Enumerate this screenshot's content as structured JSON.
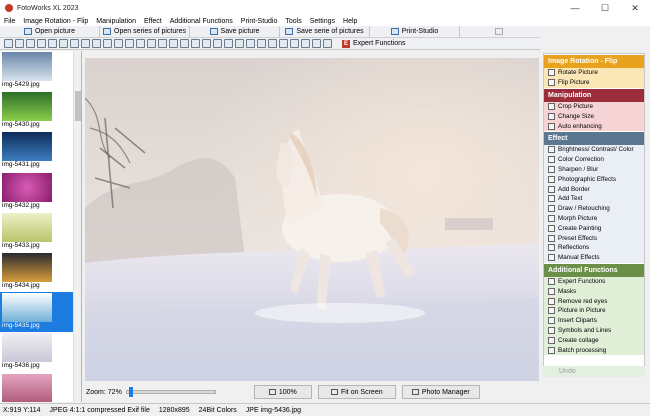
{
  "window": {
    "title": "FotoWorks XL 2023",
    "min": "—",
    "max": "☐",
    "close": "✕"
  },
  "menu": [
    "File",
    "Image Rotation - Flip",
    "Manipulation",
    "Effect",
    "Additional Functions",
    "Print-Studio",
    "Tools",
    "Settings",
    "Help"
  ],
  "toolbar": {
    "open_picture": "Open picture",
    "open_series": "Open series of pictures",
    "save_picture": "Save picture",
    "save_series": "Save serie of pictures",
    "print_studio": "Print-Studio",
    "disabled_label": "",
    "expert_functions": "Expert Functions"
  },
  "thumbnails": [
    {
      "name": "img-5429.jpg",
      "color1": "#6a86a8",
      "color2": "#d8e3ee"
    },
    {
      "name": "img-5430.jpg",
      "color1": "#2d6e2a",
      "color2": "#8ccf4a"
    },
    {
      "name": "img-5431.jpg",
      "color1": "#0d2c5a",
      "color2": "#3d7ec0"
    },
    {
      "name": "img-5432.jpg",
      "color1": "#8a1d6e",
      "color2": "#d85bb4"
    },
    {
      "name": "img-5433.jpg",
      "color1": "#b9c46a",
      "color2": "#eef0c8"
    },
    {
      "name": "img-5434.jpg",
      "color1": "#2a2a30",
      "color2": "#d89e3a"
    },
    {
      "name": "img-5435.jpg",
      "color1": "#6fb0d6",
      "color2": "#ffffff"
    },
    {
      "name": "img-5436.jpg",
      "color1": "#c8c8d8",
      "color2": "#f0eef2"
    },
    {
      "name": "",
      "color1": "#b05a7a",
      "color2": "#e2a4c0"
    }
  ],
  "selected_thumb": "img-5435.jpg",
  "zoom": {
    "label": "Zoom: 72%",
    "btn_100": "100%",
    "btn_fit": "Fit on Screen",
    "btn_manager": "Photo Manager"
  },
  "panel": {
    "rotation_title": "Image Rotation - Flip",
    "rotation_items": [
      "Rotate Picture",
      "Flip Picture"
    ],
    "manip_title": "Manipulation",
    "manip_items": [
      "Crop Picture",
      "Change Size",
      "Auto enhancing"
    ],
    "effect_title": "Effect",
    "effect_items": [
      "Brightness/ Contrast/ Color",
      "Color Correction",
      "Sharpen / Blur",
      "Photographic Effects",
      "Add Border",
      "Add Text",
      "Draw / Retouching",
      "Morph Picture",
      "Create Painting",
      "Preset Effects",
      "Reflections",
      "Manual Effects"
    ],
    "add_title": "Additional Functions",
    "add_items": [
      "Expert Functions",
      "Masks",
      "Remove red eyes",
      "Picture in Picture",
      "Insert Cliparts",
      "Symbols and Lines",
      "Create collage",
      "Batch processing"
    ],
    "undo": "Undo"
  },
  "colors": {
    "rotation": "#e8a21e",
    "manipulation": "#9b2c3a",
    "effect": "#5b7790",
    "additional": "#6b8f47",
    "selected": "#1c7ce0"
  },
  "status": {
    "coords": "X:919 Y:114",
    "format": "JPEG 4:1:1 compressed Exif file",
    "dims": "1280x895",
    "depth": "24Bit Colors",
    "file": "JPE img-5436.jpg"
  }
}
